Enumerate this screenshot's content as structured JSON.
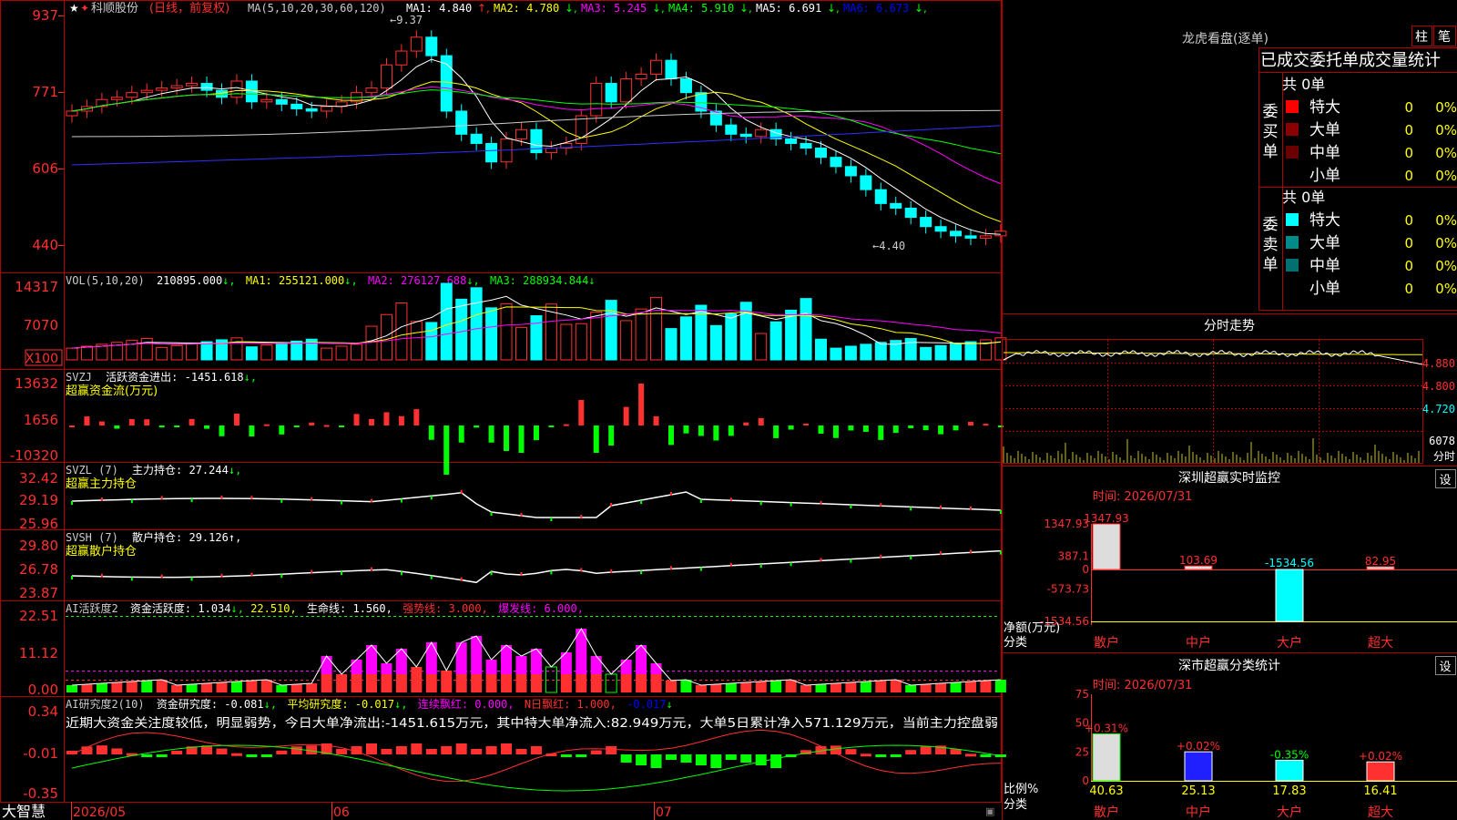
{
  "stock": {
    "name": "科顺股份",
    "period_label": "(日线，前复权)",
    "ma_header": "MA(5,10,20,30,60,120)",
    "ma_values": [
      {
        "label": "MA1: 4.840",
        "arrow": "↑",
        "color": "#ffffff"
      },
      {
        "label": "MA2: 4.780",
        "arrow": "↓",
        "color": "#ffff00"
      },
      {
        "label": "MA3: 5.245",
        "arrow": "↓",
        "color": "#ff00ff"
      },
      {
        "label": "MA4: 5.910",
        "arrow": "↓",
        "color": "#00ff00"
      },
      {
        "label": "MA5: 6.691",
        "arrow": "↓",
        "color": "#ffffff"
      },
      {
        "label": "MA6: 6.673",
        "arrow": "↓",
        "color": "#0000ff"
      }
    ],
    "high_label": "9.37",
    "low_label": "4.40"
  },
  "price_axis": [
    "937",
    "771",
    "606",
    "440"
  ],
  "vol_panel": {
    "title": "VOL(5,10,20)",
    "value": "210895.000",
    "ma1": "MA1: 255121.000",
    "ma2": "MA2: 276127.688",
    "ma3": "MA3: 288934.844",
    "axis": [
      "14317",
      "7070"
    ],
    "unit": "X100"
  },
  "svzj_panel": {
    "title": "SVZJ",
    "label": "活跃资金进出: -1451.618",
    "subtitle": "超赢资金流(万元)",
    "axis": [
      "13632",
      "1656",
      "-10320"
    ]
  },
  "svzl_panel": {
    "title": "SVZL (7)",
    "label": "主力持仓: 27.244",
    "subtitle": "超赢主力持仓",
    "axis": [
      "32.42",
      "29.19",
      "25.96"
    ]
  },
  "svsh_panel": {
    "title": "SVSH (7)",
    "label": "散户持仓: 29.126",
    "subtitle": "超赢散户持仓",
    "axis": [
      "29.80",
      "26.78",
      "23.87"
    ]
  },
  "ai_active_panel": {
    "title": "AI活跃度2",
    "label1": "资金活跃度: 1.034",
    "label2": "22.510",
    "label3": "生命线: 1.560",
    "label4": "强势线: 3.000",
    "label5": "爆发线: 6.000",
    "axis": [
      "22.51",
      "11.12",
      "0.00"
    ]
  },
  "ai_research_panel": {
    "title": "AI研究度2(10)",
    "label1": "资金研究度: -0.081",
    "label2": "平均研究度: -0.017",
    "label3": "连续飘红: 0.000",
    "label4": "N日飘红: 1.000",
    "label5": "-0.017",
    "comment": "近期大资金关注度较低，明显弱势，今日大单净流出:-1451.615万元，其中特大单净流入:82.949万元，大单5日累计净入571.129万元，当前主力控盘弱",
    "axis": [
      "0.34",
      "-0.01",
      "-0.35"
    ]
  },
  "date_axis": {
    "brand": "大智慧",
    "labels": [
      "2026/05",
      "06",
      "07"
    ]
  },
  "right_panel": {
    "longhu_title": "龙虎看盘(逐单)",
    "tab_zhu": "柱",
    "tab_bi": "笔",
    "stats_title": "已成交委托单成交量统计",
    "buy_group": "委买单",
    "sell_group": "委卖单",
    "total_buy": "共 0单",
    "total_sell": "共 0单",
    "buy_rows": [
      {
        "name": "特大",
        "count": "0",
        "pct": "0%",
        "color": "#ff0000"
      },
      {
        "name": "大单",
        "count": "0",
        "pct": "0%",
        "color": "#8b0000"
      },
      {
        "name": "中单",
        "count": "0",
        "pct": "0%",
        "color": "#6b0000"
      },
      {
        "name": "小单",
        "count": "0",
        "pct": "0%",
        "color": ""
      }
    ],
    "sell_rows": [
      {
        "name": "特大",
        "count": "0",
        "pct": "0%",
        "color": "#00ffff"
      },
      {
        "name": "大单",
        "count": "0",
        "pct": "0%",
        "color": "#008b8b"
      },
      {
        "name": "中单",
        "count": "0",
        "pct": "0%",
        "color": "#007070"
      },
      {
        "name": "小单",
        "count": "0",
        "pct": "0%",
        "color": ""
      }
    ],
    "intraday_title": "分时走势",
    "intraday_axis": [
      "4.880",
      "4.800",
      "4.720"
    ],
    "intraday_vol": "6078",
    "intraday_vol_label": "分时",
    "monitor_title": "深圳超赢实时监控",
    "monitor_btn": "设",
    "monitor_time": "时间: 2026/07/31",
    "monitor_axis": [
      "1347.93",
      "387.1",
      "0",
      "-573.73",
      "-1534.56"
    ],
    "monitor_ylabel": "净额(万元)",
    "monitor_xlabel": "分类",
    "class_title": "深市超赢分类统计",
    "class_btn": "设",
    "class_time": "时间: 2026/07/31",
    "class_axis": [
      "75",
      "50",
      "25",
      "0"
    ],
    "class_ylabel": "比例%",
    "class_xlabel": "分类"
  },
  "chart_data": [
    {
      "type": "bar",
      "title": "深圳超赢实时监控",
      "ylabel": "净额(万元)",
      "xlabel": "分类",
      "categories": [
        "散户",
        "中户",
        "大户",
        "超大"
      ],
      "values": [
        1347.93,
        103.69,
        -1534.56,
        82.95
      ],
      "value_labels": [
        "1347.93",
        "103.69",
        "-1534.56",
        "82.95"
      ],
      "ylim": [
        -1534.56,
        1347.93
      ]
    },
    {
      "type": "bar",
      "title": "深市超赢分类统计",
      "ylabel": "比例%",
      "xlabel": "分类",
      "categories": [
        "散户",
        "中户",
        "大户",
        "超大"
      ],
      "values": [
        40.63,
        25.13,
        17.83,
        16.41
      ],
      "changes": [
        "+0.31%",
        "+0.02%",
        "-0.35%",
        "+0.02%"
      ],
      "ylim": [
        0,
        75
      ]
    }
  ]
}
